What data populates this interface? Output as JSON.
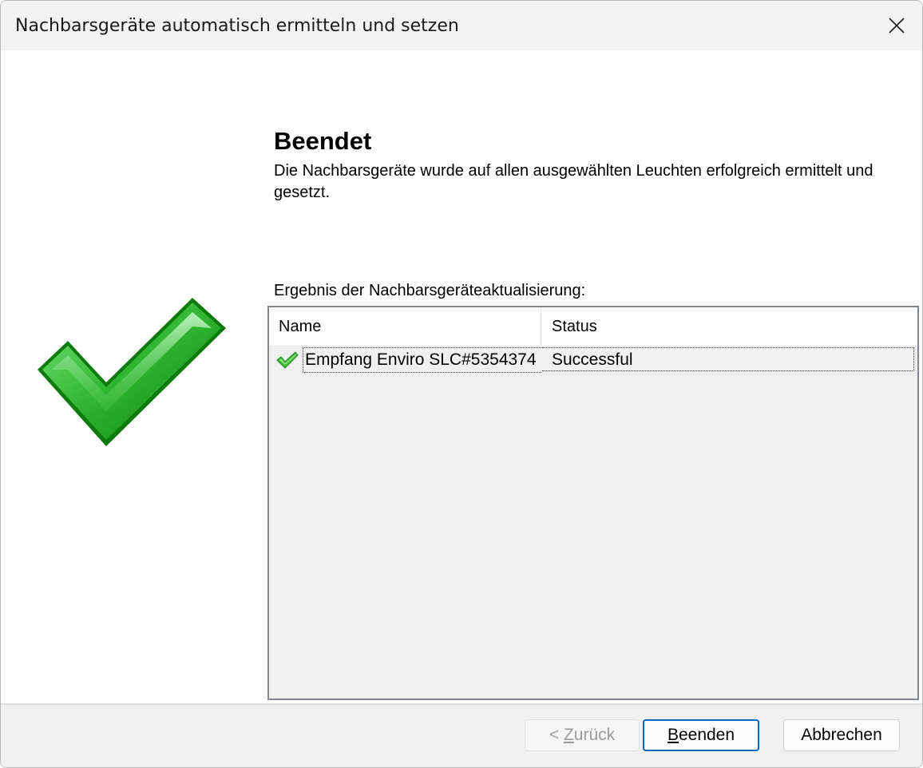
{
  "window": {
    "title": "Nachbarsgeräte automatisch ermitteln und setzen"
  },
  "content": {
    "heading": "Beendet",
    "description": "Die Nachbarsgeräte wurde auf allen ausgewählten Leuchten erfolgreich ermittelt und gesetzt.",
    "result_label": "Ergebnis der Nachbarsgeräteaktualisierung:"
  },
  "listview": {
    "columns": [
      "Name",
      "Status"
    ],
    "rows": [
      {
        "icon": "check-icon",
        "name": "Empfang Enviro SLC#5354374",
        "status": "Successful"
      }
    ]
  },
  "buttons": {
    "back_prefix": "< ",
    "back_mnemonic": "Z",
    "back_rest": "urück",
    "finish_mnemonic": "B",
    "finish_rest": "eenden",
    "cancel_label": "Abbrechen"
  },
  "icons": {
    "close": "close-icon",
    "success": "green-checkmark-icon"
  },
  "colors": {
    "accent": "#0067c0",
    "check_green": "#2fb52f"
  }
}
